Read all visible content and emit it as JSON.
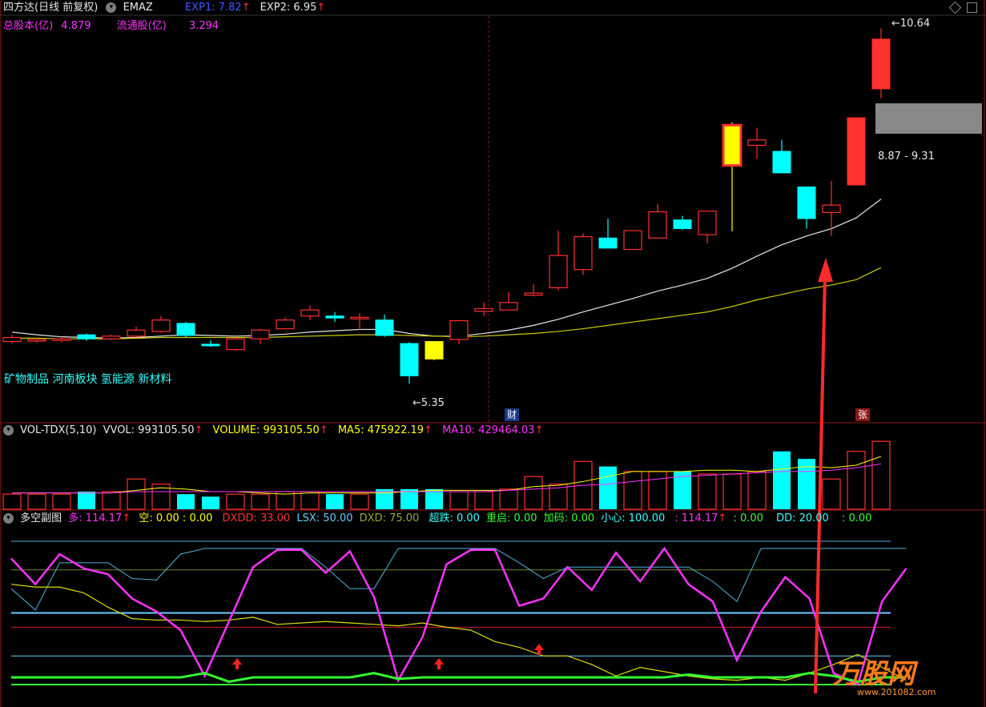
{
  "colors": {
    "bg": "#000000",
    "up": "#ff3030",
    "down": "#00ffff",
    "white": "#e8e8e8",
    "yellow": "#ffff00",
    "magenta": "#ff33ff",
    "green": "#33ff33",
    "grid": "#8b1a1a"
  },
  "main_header": {
    "stock_title": "四方达(日线 前复权)",
    "indicator": "EMAZ",
    "exp1": "EXP1: 7.82",
    "exp2": "EXP2: 6.95",
    "total_share_label": "总股本(亿)",
    "total_share_value": "4.879",
    "float_share_label": "流通股(亿)",
    "float_share_value": "3.294"
  },
  "price_labels": {
    "high": "10.64",
    "low": "5.35",
    "range": "8.87 - 9.31",
    "concepts": "矿物制品 河南板块 氢能源 新材料",
    "marker_cai": "财",
    "marker_zhang": "张"
  },
  "vol_header": {
    "title": "VOL-TDX(5,10)",
    "vvol": "VVOL: 993105.50",
    "volume": "VOLUME: 993105.50",
    "ma5": "MA5: 475922.19",
    "ma10": "MA10: 429464.03"
  },
  "sub_header": {
    "title": "多空副图",
    "duo": "多: 114.17",
    "kong": "空: 0.00 : 0.00",
    "dxdd": "DXDD: 33.00",
    "lsx": "LSX: 50.00",
    "dxd": "DXD: 75.00",
    "chaodie": "超跌: 0.00",
    "chongqi": "重启: 0.00",
    "jiama": "加码: 0.00",
    "xiaoxin": "小心: 100.00",
    "v1": ": 114.17",
    "v2": ": 0.00",
    "dd": "DD: 20.00",
    "v3": ": 0.00"
  },
  "watermark": {
    "brand": "万股网",
    "url": "www.201082.com"
  },
  "chart_data": {
    "type": "candlestick",
    "candles": [
      {
        "o": 5.98,
        "c": 6.04,
        "h": 6.08,
        "l": 5.95
      },
      {
        "o": 5.99,
        "c": 6.01,
        "h": 6.03,
        "l": 5.96
      },
      {
        "o": 6.0,
        "c": 6.02,
        "h": 6.05,
        "l": 5.97
      },
      {
        "o": 6.08,
        "c": 6.02,
        "h": 6.1,
        "l": 5.99
      },
      {
        "o": 6.02,
        "c": 6.06,
        "h": 6.08,
        "l": 6.0
      },
      {
        "o": 6.06,
        "c": 6.15,
        "h": 6.2,
        "l": 6.04
      },
      {
        "o": 6.13,
        "c": 6.3,
        "h": 6.36,
        "l": 6.11
      },
      {
        "o": 6.25,
        "c": 6.07,
        "h": 6.27,
        "l": 6.04
      },
      {
        "o": 5.94,
        "c": 5.92,
        "h": 6.0,
        "l": 5.9
      },
      {
        "o": 5.86,
        "c": 6.02,
        "h": 6.04,
        "l": 5.84
      },
      {
        "o": 6.02,
        "c": 6.15,
        "h": 6.17,
        "l": 5.94
      },
      {
        "o": 6.17,
        "c": 6.3,
        "h": 6.34,
        "l": 6.17
      },
      {
        "o": 6.36,
        "c": 6.45,
        "h": 6.52,
        "l": 6.3
      },
      {
        "o": 6.36,
        "c": 6.33,
        "h": 6.42,
        "l": 6.27
      },
      {
        "o": 6.34,
        "c": 6.34,
        "h": 6.4,
        "l": 6.15
      },
      {
        "o": 6.3,
        "c": 6.07,
        "h": 6.38,
        "l": 6.05
      },
      {
        "o": 5.95,
        "c": 5.47,
        "h": 5.97,
        "l": 5.35
      },
      {
        "o": 5.98,
        "c": 5.72,
        "h": 5.98,
        "l": 5.7
      },
      {
        "o": 6.01,
        "c": 6.29,
        "h": 6.29,
        "l": 5.94
      },
      {
        "o": 6.43,
        "c": 6.47,
        "h": 6.56,
        "l": 6.36
      },
      {
        "o": 6.45,
        "c": 6.56,
        "h": 6.72,
        "l": 6.45
      },
      {
        "o": 6.67,
        "c": 6.7,
        "h": 6.83,
        "l": 6.65
      },
      {
        "o": 6.78,
        "c": 7.26,
        "h": 7.63,
        "l": 6.74
      },
      {
        "o": 7.05,
        "c": 7.54,
        "h": 7.59,
        "l": 6.97
      },
      {
        "o": 7.52,
        "c": 7.37,
        "h": 7.81,
        "l": 7.37
      },
      {
        "o": 7.35,
        "c": 7.63,
        "h": 7.63,
        "l": 7.35
      },
      {
        "o": 7.52,
        "c": 7.91,
        "h": 8.03,
        "l": 7.52
      },
      {
        "o": 7.79,
        "c": 7.66,
        "h": 7.85,
        "l": 7.64
      },
      {
        "o": 7.57,
        "c": 7.92,
        "h": 7.92,
        "l": 7.44
      },
      {
        "o": 8.6,
        "c": 9.2,
        "h": 9.24,
        "l": 7.62
      },
      {
        "o": 8.9,
        "c": 8.98,
        "h": 9.16,
        "l": 8.7
      },
      {
        "o": 8.81,
        "c": 8.49,
        "h": 8.98,
        "l": 8.49
      },
      {
        "o": 8.28,
        "c": 7.81,
        "h": 8.28,
        "l": 7.66
      },
      {
        "o": 7.9,
        "c": 8.01,
        "h": 8.37,
        "l": 7.55
      },
      {
        "o": 8.31,
        "c": 9.31,
        "h": 9.31,
        "l": 8.31
      },
      {
        "o": 9.74,
        "c": 10.48,
        "h": 10.64,
        "l": 9.6
      }
    ],
    "ma_white": [
      6.12,
      6.08,
      6.05,
      6.04,
      6.03,
      6.04,
      6.06,
      6.08,
      6.07,
      6.06,
      6.07,
      6.09,
      6.12,
      6.14,
      6.16,
      6.16,
      6.1,
      6.06,
      6.06,
      6.1,
      6.15,
      6.22,
      6.31,
      6.42,
      6.52,
      6.62,
      6.73,
      6.82,
      6.92,
      7.07,
      7.25,
      7.42,
      7.55,
      7.66,
      7.82,
      8.1
    ],
    "ma_yellow": [
      6.03,
      6.03,
      6.02,
      6.02,
      6.02,
      6.03,
      6.04,
      6.04,
      6.04,
      6.04,
      6.04,
      6.05,
      6.06,
      6.07,
      6.08,
      6.08,
      6.07,
      6.06,
      6.05,
      6.06,
      6.08,
      6.1,
      6.13,
      6.17,
      6.22,
      6.27,
      6.32,
      6.37,
      6.42,
      6.5,
      6.6,
      6.68,
      6.76,
      6.82,
      6.9,
      7.08
    ],
    "volume": [
      12,
      12,
      12,
      14,
      14,
      24,
      20,
      12,
      10,
      12,
      12,
      14,
      14,
      12,
      12,
      16,
      16,
      16,
      14,
      14,
      16,
      26,
      20,
      38,
      34,
      30,
      30,
      30,
      28,
      28,
      30,
      46,
      40,
      24,
      46,
      54
    ],
    "vol_ma5": [
      13,
      13,
      13,
      13,
      13,
      15,
      17,
      16,
      14,
      14,
      13,
      12,
      13,
      13,
      13,
      13,
      14,
      15,
      15,
      15,
      15,
      18,
      19,
      22,
      26,
      30,
      30,
      30,
      31,
      31,
      30,
      32,
      34,
      33,
      35,
      42
    ],
    "vol_ma10": [
      13,
      13,
      13,
      13,
      13,
      14,
      14,
      14,
      14,
      14,
      14,
      14,
      14,
      14,
      14,
      14,
      14,
      14,
      14,
      14,
      15,
      16,
      17,
      19,
      20,
      22,
      24,
      26,
      27,
      28,
      29,
      30,
      30,
      31,
      33,
      36
    ],
    "duo_line": [
      88,
      70,
      91,
      81,
      77,
      60,
      51,
      38,
      6,
      44,
      82,
      94,
      94,
      78,
      93,
      61,
      3,
      33,
      84,
      94,
      94,
      55,
      60,
      82,
      66,
      92,
      72,
      95,
      70,
      58,
      17,
      51,
      75,
      60,
      8,
      0,
      58,
      81
    ],
    "yellow_line": [
      70,
      68,
      68,
      64,
      54,
      46,
      45,
      45,
      44,
      45,
      47,
      42,
      43,
      44,
      43,
      42,
      41,
      43,
      40,
      38,
      30,
      26,
      20,
      20,
      14,
      6,
      12,
      9,
      6,
      4,
      3,
      5,
      3,
      8,
      14,
      21,
      12,
      3
    ],
    "cyan_line": [
      67,
      52,
      85,
      85,
      85,
      74,
      73,
      91,
      95,
      95,
      95,
      95,
      95,
      82,
      67,
      67,
      95,
      95,
      95,
      95,
      95,
      85,
      74,
      82,
      82,
      82,
      82,
      82,
      82,
      72,
      58,
      95,
      95,
      95,
      95,
      95,
      95,
      95
    ],
    "green_line": [
      5,
      5,
      5,
      5,
      5,
      5,
      5,
      5,
      8,
      2,
      5,
      5,
      5,
      5,
      5,
      8,
      4,
      5,
      5,
      5,
      5,
      5,
      5,
      5,
      5,
      5,
      5,
      5,
      7,
      5,
      5,
      5,
      5,
      8,
      6,
      2,
      5,
      5
    ],
    "ylim_price": [
      5.2,
      10.8
    ],
    "h_levels": [
      100,
      80,
      50,
      40,
      20,
      0
    ]
  }
}
